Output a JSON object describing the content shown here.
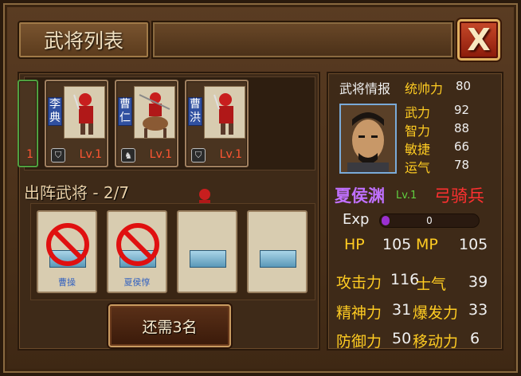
{
  "window": {
    "title": "武将列表",
    "close_label": "X"
  },
  "roster": [
    {
      "name": "",
      "level": "1",
      "partial": true
    },
    {
      "name": "李典",
      "level": "Lv.1",
      "type_icon": "shield-icon"
    },
    {
      "name": "曹仁",
      "level": "Lv.1",
      "type_icon": "horse-icon"
    },
    {
      "name": "曹洪",
      "level": "Lv.1",
      "type_icon": "shield-icon"
    }
  ],
  "deploy": {
    "title": "出阵武将 - 2/7",
    "slots": [
      {
        "name": "曹操",
        "blocked": true
      },
      {
        "name": "夏侯惇",
        "blocked": true
      },
      {
        "name": "",
        "blocked": false
      },
      {
        "name": "",
        "blocked": false
      }
    ],
    "button_label": "还需3名"
  },
  "info": {
    "header": "武将情报",
    "leadership_label": "统帅力",
    "leadership": "80",
    "stats": [
      {
        "label": "武力",
        "value": "92"
      },
      {
        "label": "智力",
        "value": "88"
      },
      {
        "label": "敏捷",
        "value": "66"
      },
      {
        "label": "运气",
        "value": "78"
      }
    ],
    "name": "夏侯渊",
    "level": "Lv.1",
    "class": "弓骑兵",
    "exp_label": "Exp",
    "exp_value": "0",
    "exp_fraction": 0.0,
    "hp_label": "HP",
    "hp": "105",
    "mp_label": "MP",
    "mp": "105",
    "combat": [
      {
        "label": "攻击力",
        "value": "116"
      },
      {
        "label": "士气",
        "value": "39"
      },
      {
        "label": "精神力",
        "value": "31"
      },
      {
        "label": "爆发力",
        "value": "33"
      },
      {
        "label": "防御力",
        "value": "50"
      },
      {
        "label": "移动力",
        "value": "6"
      }
    ]
  },
  "colors": {
    "accent": "#ffcc22",
    "name": "#c070ff",
    "class": "#ff3030",
    "level": "#ff5533"
  }
}
